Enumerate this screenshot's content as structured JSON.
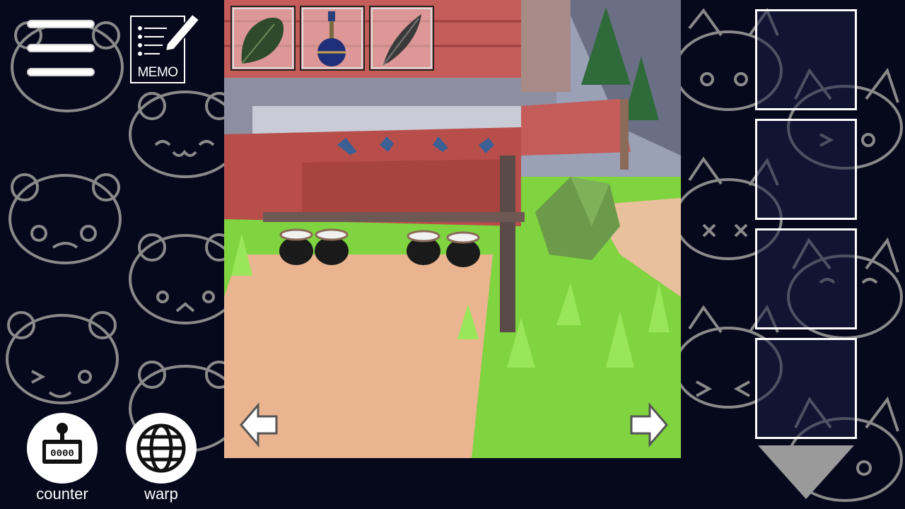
{
  "hud": {
    "menu_icon": "hamburger-menu-icon",
    "memo_label": "MEMO",
    "counter_label": "counter",
    "warp_label": "warp",
    "counter_display": "0000"
  },
  "inventory": [
    {
      "name": "leaf",
      "icon": "leaf-icon"
    },
    {
      "name": "potion",
      "icon": "potion-bottle-icon"
    },
    {
      "name": "feather",
      "icon": "feather-icon"
    }
  ],
  "side_slots": [
    "slot-1",
    "slot-2",
    "slot-3",
    "slot-4"
  ],
  "colors": {
    "background": "#06081c",
    "face_outline": "#8a8a8a",
    "awning": "#b84e4a",
    "grass": "#7fd43f",
    "path": "#e9b48f"
  }
}
